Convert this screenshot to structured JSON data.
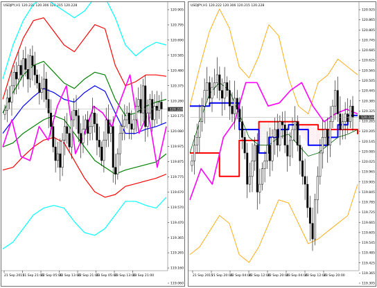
{
  "colors": {
    "background": "#ffffff",
    "frame": "#6e6e6e",
    "candle": "#000000",
    "current_price_line": "#a8a8a8",
    "current_price_box": "#3a3a3a",
    "bollinger_outer": "#00ffff",
    "bollinger_mid": "#ff0000",
    "bollinger_inner": "#008000",
    "ma": "#0000ff",
    "chikou": "#ff00ff",
    "envelope": "#ffa500",
    "cloud": "#ff0000"
  },
  "chart_data": [
    {
      "type": "candlestick",
      "title": "USDJPY,H1  120.222 120.306 120.215 120.228",
      "ylim": [
        119.06,
        120.97
      ],
      "y_ticks": [
        "120.905",
        "120.795",
        "120.690",
        "120.585",
        "120.480",
        "120.375",
        "120.280",
        "120.175",
        "120.080",
        "119.975",
        "119.875",
        "119.775",
        "119.670",
        "119.570",
        "119.470",
        "119.365",
        "119.265",
        "119.160",
        "119.060"
      ],
      "x_ticks": [
        "21 Sep 2015",
        "21 Sep 21:00",
        "22 Sep 05:00",
        "22 Sep 13:00",
        "22 Sep 21:00",
        "23 Sep 05:00",
        "23 Sep 13:00",
        "23 Sep 21:00"
      ],
      "current_price": "120.228",
      "close": [
        120.22,
        120.31,
        120.28,
        120.4,
        120.5,
        120.45,
        120.55,
        120.48,
        120.6,
        120.52,
        120.45,
        120.62,
        120.55,
        120.48,
        120.42,
        120.35,
        120.38,
        120.45,
        120.3,
        120.2,
        120.1,
        119.95,
        119.85,
        119.9,
        119.8,
        120.0,
        120.1,
        120.05,
        119.95,
        120.15,
        120.22,
        120.18,
        120.05,
        119.98,
        120.08,
        120.15,
        120.05,
        120.1,
        120.2,
        120.12,
        120.0,
        119.95,
        119.85,
        120.0,
        120.15,
        120.05,
        120.1,
        119.8,
        119.75,
        119.9,
        120.05,
        120.1,
        120.15,
        120.2,
        120.12,
        120.08,
        120.15,
        120.25,
        120.3,
        120.2,
        120.4,
        120.1,
        120.2,
        120.3,
        120.15,
        120.25,
        120.22,
        120.28,
        120.228
      ],
      "series": [
        {
          "name": "",
          "role": "band-outer-upper",
          "color": "#00ffff",
          "values": [
            120.45,
            120.7,
            120.88,
            121.0,
            121.05,
            121.0,
            120.95,
            120.9,
            120.95,
            121.05,
            121.05,
            120.9,
            120.7,
            120.62,
            120.68,
            120.72,
            120.7
          ]
        },
        {
          "name": "",
          "role": "band-mid-upper",
          "color": "#ff0000",
          "values": [
            120.3,
            120.55,
            120.75,
            120.88,
            120.9,
            120.8,
            120.7,
            120.65,
            120.75,
            120.85,
            120.82,
            120.55,
            120.4,
            120.43,
            120.48,
            120.48,
            120.47
          ]
        },
        {
          "name": "",
          "role": "band-inner-upper",
          "color": "#008000",
          "values": [
            120.2,
            120.35,
            120.48,
            120.55,
            120.58,
            120.5,
            120.42,
            120.38,
            120.45,
            120.5,
            120.48,
            120.3,
            120.18,
            120.2,
            120.25,
            120.28,
            120.3
          ]
        },
        {
          "name": "",
          "role": "moving-average",
          "color": "#0000ff",
          "values": [
            120.05,
            120.15,
            120.25,
            120.32,
            120.38,
            120.35,
            120.3,
            120.28,
            120.35,
            120.4,
            120.36,
            120.2,
            120.05,
            120.05,
            120.08,
            120.1,
            120.13
          ]
        },
        {
          "name": "",
          "role": "band-inner-lower",
          "color": "#008000",
          "values": [
            119.95,
            119.98,
            120.05,
            120.1,
            120.15,
            120.18,
            120.15,
            120.05,
            119.95,
            119.85,
            119.8,
            119.75,
            119.78,
            119.8,
            119.82,
            119.84,
            119.9
          ]
        },
        {
          "name": "",
          "role": "band-mid-lower",
          "color": "#ff0000",
          "values": [
            119.78,
            119.8,
            119.88,
            119.95,
            120.0,
            120.02,
            119.98,
            119.85,
            119.72,
            119.62,
            119.58,
            119.6,
            119.66,
            119.68,
            119.7,
            119.72,
            119.75
          ]
        },
        {
          "name": "",
          "role": "band-outer-lower",
          "color": "#00ffff",
          "values": [
            119.2,
            119.25,
            119.35,
            119.45,
            119.5,
            119.52,
            119.5,
            119.4,
            119.32,
            119.3,
            119.35,
            119.45,
            119.55,
            119.55,
            119.52,
            119.5,
            119.58
          ]
        },
        {
          "name": "",
          "role": "lagging-line",
          "color": "#ff00ff",
          "values": [
            119.95,
            120.15,
            119.88,
            119.85,
            120.1,
            120.0,
            120.25,
            120.4,
            119.9,
            120.05,
            120.25,
            120.2,
            120.1,
            120.3,
            120.48,
            120.05,
            120.2,
            119.8,
            120.1
          ]
        }
      ]
    },
    {
      "type": "candlestick",
      "title": "USDJPY,H1  120.222 120.306 120.215 120.228",
      "ylim": [
        119.265,
        120.925
      ],
      "y_ticks": [
        "120.925",
        "120.865",
        "120.805",
        "120.745",
        "120.685",
        "120.625",
        "120.565",
        "120.505",
        "120.445",
        "120.385",
        "120.325",
        "120.265",
        "120.205",
        "120.145",
        "120.085",
        "120.025",
        "119.965",
        "119.905",
        "119.845",
        "119.785",
        "119.725",
        "119.665",
        "119.605",
        "119.545",
        "119.485",
        "119.425",
        "119.365",
        "119.305"
      ],
      "x_ticks": [
        "21 Sep 2015",
        "21 Sep 20:00",
        "22 Sep 04:00",
        "22 Sep 12:00",
        "22 Sep 20:00",
        "23 Sep 04:00",
        "23 Sep 12:00",
        "23 Sep 20:00"
      ],
      "current_price": "120.228",
      "close": [
        119.95,
        120.05,
        120.1,
        120.2,
        120.3,
        120.4,
        120.45,
        120.35,
        120.42,
        120.45,
        120.5,
        120.4,
        120.35,
        120.45,
        120.4,
        120.3,
        120.25,
        120.35,
        120.28,
        120.2,
        120.1,
        120.0,
        119.8,
        119.85,
        119.95,
        120.05,
        119.75,
        119.8,
        119.9,
        119.95,
        120.05,
        119.95,
        120.1,
        120.15,
        120.05,
        120.2,
        120.18,
        120.05,
        119.98,
        120.08,
        120.15,
        120.2,
        120.05,
        119.95,
        119.85,
        119.8,
        119.65,
        119.55,
        119.45,
        119.7,
        119.85,
        120.0,
        120.1,
        120.15,
        120.05,
        120.2,
        120.3,
        120.4,
        120.25,
        120.15,
        120.2,
        120.25,
        120.2,
        120.3,
        120.228
      ],
      "series": [
        {
          "name": "",
          "role": "envelope-upper",
          "color": "#ffa500",
          "values": [
            120.3,
            120.55,
            120.78,
            120.92,
            120.8,
            120.55,
            120.48,
            120.62,
            120.82,
            120.75,
            120.48,
            120.3,
            120.25,
            120.45,
            120.5,
            120.6,
            120.55,
            120.5
          ]
        },
        {
          "name": "",
          "role": "envelope-lower",
          "color": "#ffa500",
          "values": [
            119.35,
            119.4,
            119.5,
            119.6,
            119.55,
            119.35,
            119.3,
            119.4,
            119.55,
            119.7,
            119.68,
            119.55,
            119.42,
            119.45,
            119.5,
            119.55,
            119.6,
            119.8
          ]
        },
        {
          "name": "",
          "role": "base-line",
          "color": "#ff0000",
          "values": [
            120.0,
            120.0,
            120.0,
            119.85,
            119.85,
            120.08,
            120.08,
            120.2,
            120.2,
            120.2,
            120.2,
            120.18,
            120.18,
            120.15,
            120.15,
            120.15,
            120.15,
            120.12
          ]
        },
        {
          "name": "",
          "role": "conversion-line",
          "color": "#0000ff",
          "values": [
            120.3,
            120.3,
            120.32,
            120.32,
            120.32,
            120.15,
            120.15,
            120.0,
            120.1,
            120.15,
            120.18,
            120.15,
            120.05,
            120.05,
            120.1,
            120.18,
            120.24,
            120.24
          ]
        },
        {
          "name": "",
          "role": "moving-average",
          "color": "#006400",
          "values": [
            120.0,
            120.2,
            120.38,
            120.45,
            120.4,
            120.25,
            120.1,
            120.05,
            120.05,
            120.1,
            120.12,
            120.05,
            119.98,
            120.0,
            120.05,
            120.1,
            120.12,
            120.15
          ]
        },
        {
          "name": "",
          "role": "lagging-line",
          "color": "#ff00ff",
          "values": [
            119.7,
            119.9,
            119.8,
            120.1,
            120.2,
            120.45,
            120.45,
            120.3,
            120.32,
            120.4,
            120.45,
            120.3,
            120.2,
            120.25,
            120.28,
            120.25
          ]
        }
      ]
    }
  ]
}
